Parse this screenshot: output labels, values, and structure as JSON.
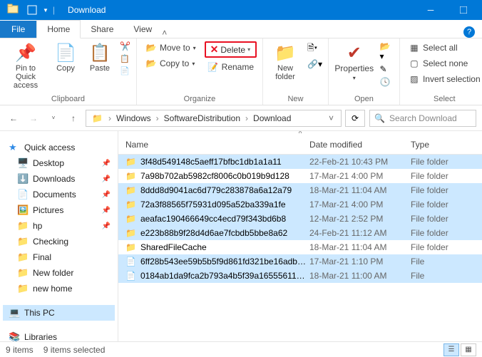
{
  "titlebar": {
    "title": "Download"
  },
  "tabs": {
    "file": "File",
    "home": "Home",
    "share": "Share",
    "view": "View"
  },
  "ribbon": {
    "clipboard": {
      "label": "Clipboard",
      "pin": "Pin to Quick\naccess",
      "copy": "Copy",
      "paste": "Paste"
    },
    "organize": {
      "label": "Organize",
      "move": "Move to",
      "copy": "Copy to",
      "delete": "Delete",
      "rename": "Rename"
    },
    "new": {
      "label": "New",
      "newfolder": "New\nfolder"
    },
    "open": {
      "label": "Open",
      "properties": "Properties"
    },
    "select": {
      "label": "Select",
      "all": "Select all",
      "none": "Select none",
      "invert": "Invert selection"
    }
  },
  "breadcrumb": [
    "Windows",
    "SoftwareDistribution",
    "Download"
  ],
  "search_placeholder": "Search Download",
  "columns": {
    "name": "Name",
    "date": "Date modified",
    "type": "Type"
  },
  "nav": {
    "quick": "Quick access",
    "items": [
      {
        "icon": "desktop",
        "label": "Desktop",
        "pin": true
      },
      {
        "icon": "download",
        "label": "Downloads",
        "pin": true
      },
      {
        "icon": "doc",
        "label": "Documents",
        "pin": true
      },
      {
        "icon": "pic",
        "label": "Pictures",
        "pin": true
      },
      {
        "icon": "folder",
        "label": "hp",
        "pin": true
      },
      {
        "icon": "folder",
        "label": "Checking",
        "pin": false
      },
      {
        "icon": "folder",
        "label": "Final",
        "pin": false
      },
      {
        "icon": "folder",
        "label": "New folder",
        "pin": false
      },
      {
        "icon": "folder",
        "label": "new home",
        "pin": false
      }
    ],
    "thispc": "This PC",
    "libraries": "Libraries"
  },
  "rows": [
    {
      "sel": true,
      "icon": "folder",
      "name": "3f48d549148c5aeff17bfbc1db1a1a11",
      "date": "22-Feb-21 10:43 PM",
      "type": "File folder"
    },
    {
      "sel": false,
      "icon": "folder",
      "name": "7a98b702ab5982cf8006c0b019b9d128",
      "date": "17-Mar-21 4:00 PM",
      "type": "File folder"
    },
    {
      "sel": true,
      "icon": "folder",
      "name": "8ddd8d9041ac6d779c283878a6a12a79",
      "date": "18-Mar-21 11:04 AM",
      "type": "File folder"
    },
    {
      "sel": true,
      "icon": "folder",
      "name": "72a3f88565f75931d095a52ba339a1fe",
      "date": "17-Mar-21 4:00 PM",
      "type": "File folder"
    },
    {
      "sel": true,
      "icon": "folder",
      "name": "aeafac190466649cc4ecd79f343bd6b8",
      "date": "12-Mar-21 2:52 PM",
      "type": "File folder"
    },
    {
      "sel": true,
      "icon": "folder",
      "name": "e223b88b9f28d4d6ae7fcbdb5bbe8a62",
      "date": "24-Feb-21 11:12 AM",
      "type": "File folder"
    },
    {
      "sel": false,
      "icon": "folder",
      "name": "SharedFileCache",
      "date": "18-Mar-21 11:04 AM",
      "type": "File folder"
    },
    {
      "sel": true,
      "icon": "file",
      "name": "6ff28b543ee59b5b5f9d861fd321be16adb8…",
      "date": "17-Mar-21 1:10 PM",
      "type": "File"
    },
    {
      "sel": true,
      "icon": "file",
      "name": "0184ab1da9fca2b793a4b5f39a1655561108…",
      "date": "18-Mar-21 11:00 AM",
      "type": "File"
    }
  ],
  "status": {
    "items": "9 items",
    "selected": "9 items selected"
  }
}
